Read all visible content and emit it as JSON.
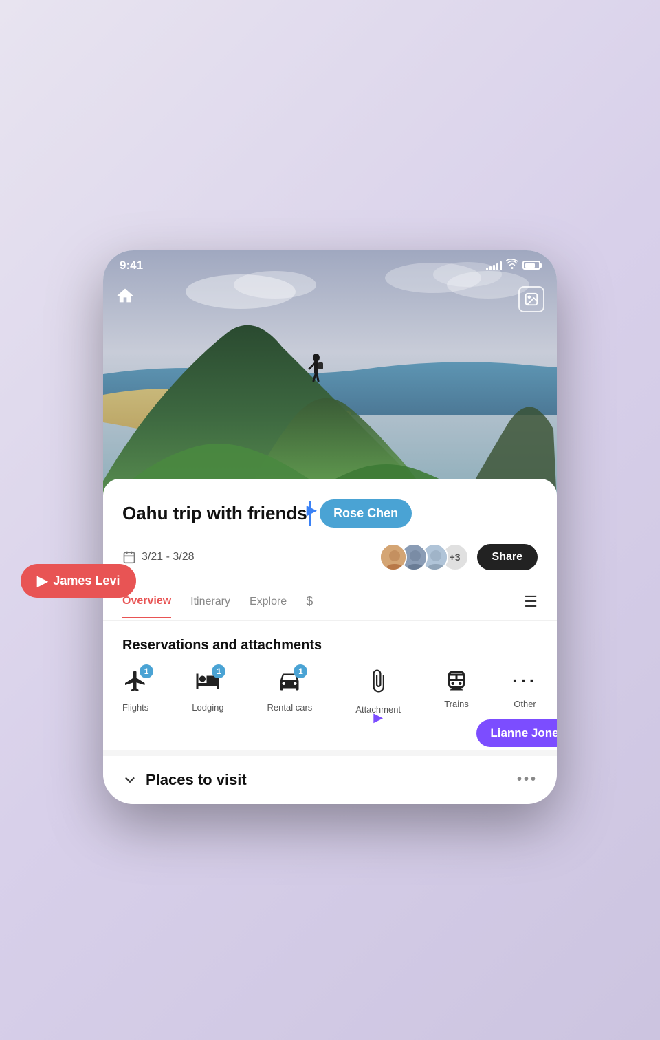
{
  "status_bar": {
    "time": "9:41",
    "signal_bars": [
      3,
      5,
      7,
      9,
      11
    ],
    "wifi": "wifi",
    "battery_level": 75
  },
  "hero": {
    "home_icon": "🏠",
    "photo_icon": "🖼"
  },
  "trip": {
    "title": "Oahu trip with friends",
    "dates": "3/21 - 3/28",
    "member_count": "+3",
    "share_label": "Share"
  },
  "tooltips": {
    "rose_chen": "Rose Chen",
    "james_levi": "James Levi",
    "lianne_jones": "Lianne Jones"
  },
  "nav_tabs": [
    {
      "label": "Overview",
      "active": true
    },
    {
      "label": "Itinerary",
      "active": false
    },
    {
      "label": "Explore",
      "active": false
    },
    {
      "label": "$",
      "active": false
    }
  ],
  "nav_menu_icon": "☰",
  "reservations": {
    "section_title": "Reservations and attachments",
    "items": [
      {
        "icon": "✈",
        "label": "Flights",
        "badge": "1",
        "has_badge": true
      },
      {
        "icon": "🛏",
        "label": "Lodging",
        "badge": "1",
        "has_badge": true
      },
      {
        "icon": "🚗",
        "label": "Rental cars",
        "badge": "1",
        "has_badge": true
      },
      {
        "icon": "📎",
        "label": "Attachment",
        "badge": null,
        "has_badge": false
      },
      {
        "icon": "🚌",
        "label": "Trains",
        "badge": null,
        "has_badge": false
      },
      {
        "icon": "•••",
        "label": "Other",
        "badge": null,
        "has_badge": false
      }
    ]
  },
  "places": {
    "title": "Places to visit",
    "chevron": "∨",
    "more_dots": "•••"
  }
}
